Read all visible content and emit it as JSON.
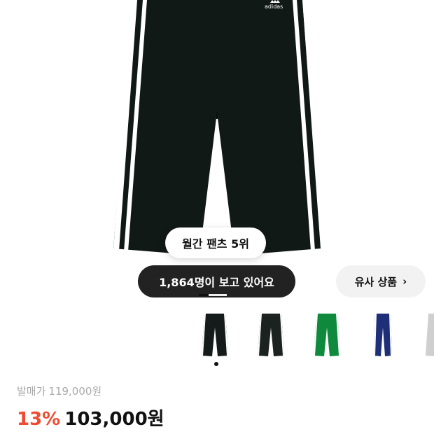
{
  "product": {
    "rank_badge": "월간 팬츠 5위",
    "viewers_badge": "1,864명이 보고 있어요",
    "similar_button": "유사 상품",
    "similar_chevron": "›",
    "brand_logo_text": "adidas"
  },
  "thumbnails": [
    {
      "name": "black-white-stripes",
      "color": "#151b1a",
      "stripe": "#ffffff"
    },
    {
      "name": "black-white-stripes-2",
      "color": "#1c2220",
      "stripe": "#ffffff"
    },
    {
      "name": "green-white-stripes",
      "color": "#0f8a3c",
      "stripe": "#ffffff"
    },
    {
      "name": "navy-white-stripes",
      "color": "#1e2f78",
      "stripe": "#ffffff"
    },
    {
      "name": "grey-white-stripes",
      "color": "#cfcfcf",
      "stripe": "#ffffff"
    }
  ],
  "pricing": {
    "original_label": "발매가",
    "original_price": "119,000원",
    "discount": "13%",
    "price": "103,000원"
  },
  "colors": {
    "discount": "#ef4b32",
    "pill_dark": "#222222"
  }
}
